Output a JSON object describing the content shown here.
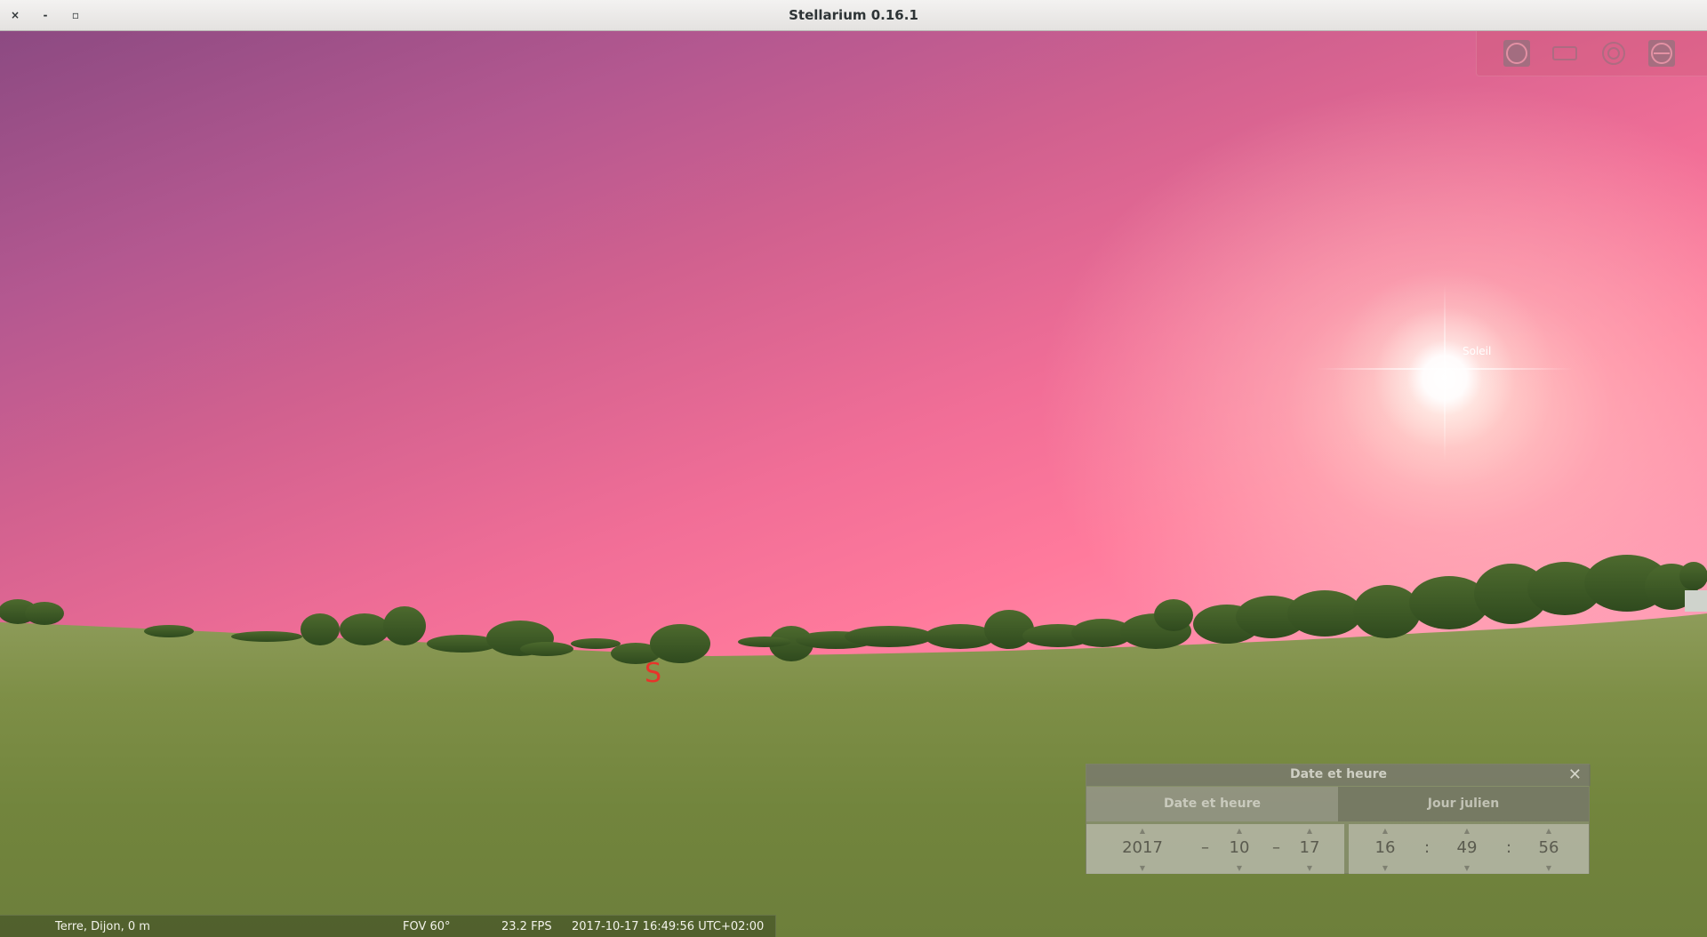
{
  "window": {
    "title": "Stellarium 0.16.1",
    "close_glyph": "×",
    "minimize_glyph": "-",
    "maximize_glyph": "▫"
  },
  "sky": {
    "sun_label": "Soleil",
    "cardinal_south": "S"
  },
  "toolbar_top_right": {
    "icons": [
      "full-screen-icon",
      "screenshot-icon",
      "night-mode-icon",
      "quit-icon"
    ]
  },
  "date_dialog": {
    "title": "Date et heure",
    "close_glyph": "✕",
    "tabs": [
      {
        "label": "Date et heure",
        "active": true
      },
      {
        "label": "Jour julien",
        "active": false
      }
    ],
    "date": {
      "year": "2017",
      "month": "10",
      "day": "17",
      "date_separator": "–"
    },
    "time": {
      "hour": "16",
      "minute": "49",
      "second": "56",
      "time_separator": ":"
    },
    "arrow_up": "▲",
    "arrow_down": "▼"
  },
  "status_bar": {
    "location": "Terre, Dijon, 0 m",
    "fov": "FOV 60°",
    "fps": "23.2 FPS",
    "datetime": "2017-10-17 16:49:56 UTC+02:00"
  },
  "colors": {
    "cardinal": "#e8332a",
    "sky_top": "#8c4a82",
    "sky_horizon": "#ffbdd0",
    "grass": "#7a8c44"
  }
}
